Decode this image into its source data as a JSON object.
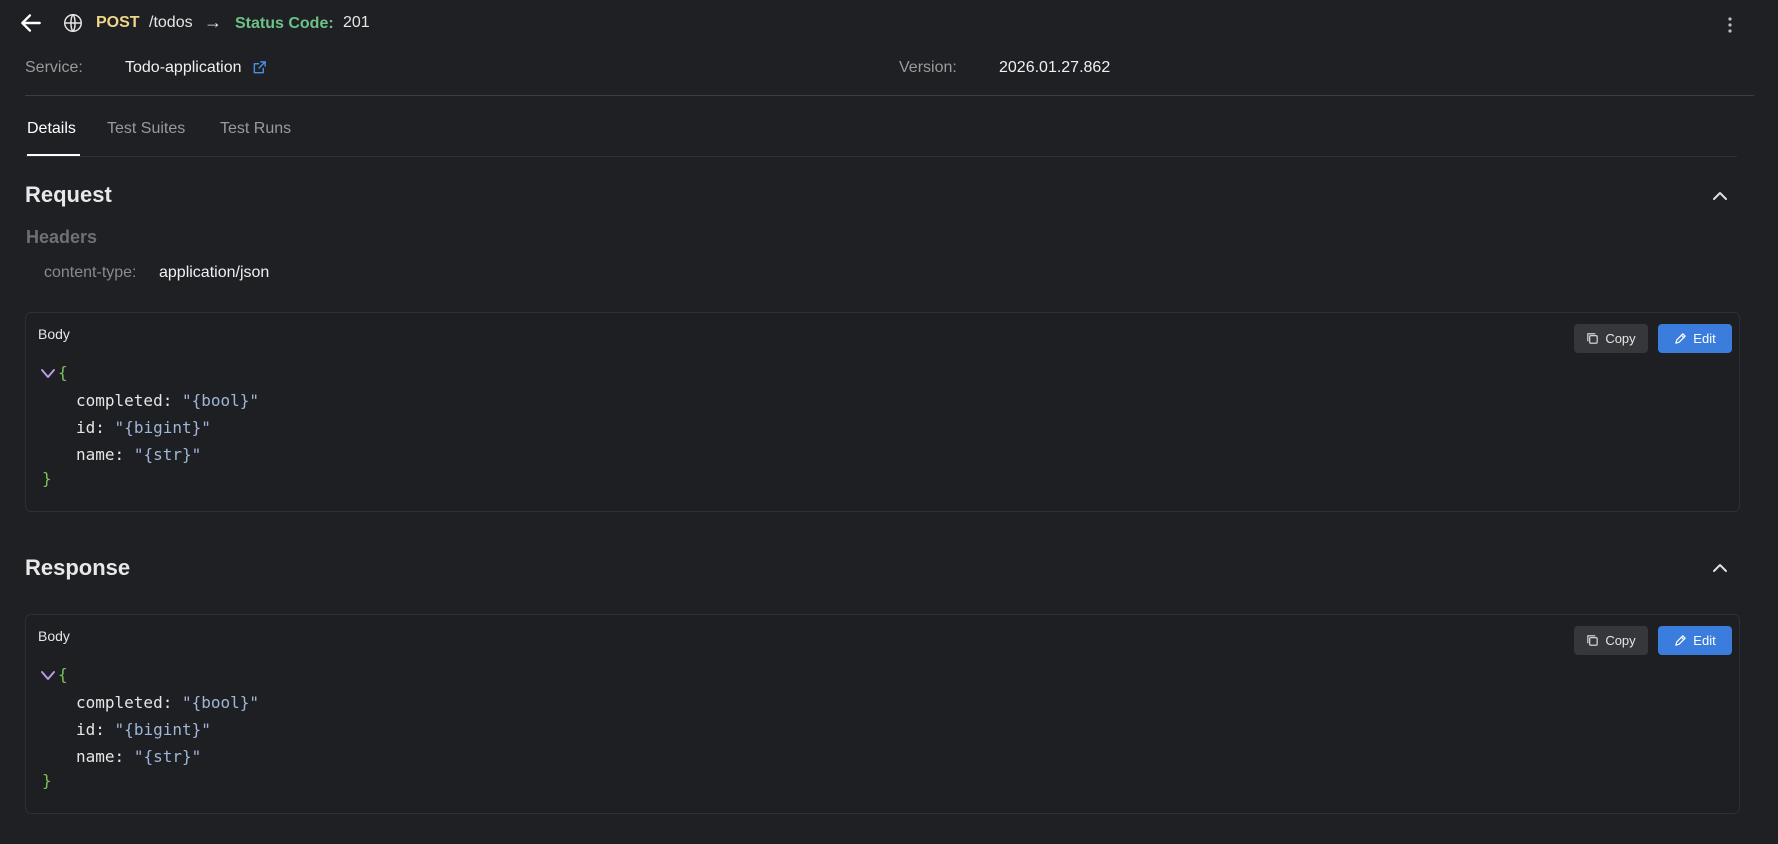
{
  "header": {
    "method": "POST",
    "path": "/todos",
    "arrow": "→",
    "status_label": "Status Code:",
    "status_value": "201",
    "icons": {
      "back": "arrow-left-icon",
      "globe": "globe-icon",
      "menu": "kebab-menu-icon"
    }
  },
  "info": {
    "service_label": "Service:",
    "service_value": "Todo-application",
    "version_label": "Version:",
    "version_value": "2026.01.27.862"
  },
  "tabs": [
    {
      "label": "Details",
      "active": true
    },
    {
      "label": "Test Suites",
      "active": false
    },
    {
      "label": "Test Runs",
      "active": false
    }
  ],
  "request": {
    "title": "Request",
    "headers_title": "Headers",
    "headers": [
      {
        "key": "content-type:",
        "value": "application/json"
      }
    ],
    "body": {
      "label": "Body",
      "copy_label": "Copy",
      "edit_label": "Edit",
      "open": "{",
      "close": "}",
      "fields": [
        {
          "key": "completed:",
          "value": "\"{bool}\""
        },
        {
          "key": "id:",
          "value": "\"{bigint}\""
        },
        {
          "key": "name:",
          "value": "\"{str}\""
        }
      ]
    }
  },
  "response": {
    "title": "Response",
    "body": {
      "label": "Body",
      "copy_label": "Copy",
      "edit_label": "Edit",
      "open": "{",
      "close": "}",
      "fields": [
        {
          "key": "completed:",
          "value": "\"{bool}\""
        },
        {
          "key": "id:",
          "value": "\"{bigint}\""
        },
        {
          "key": "name:",
          "value": "\"{str}\""
        }
      ]
    }
  },
  "colors": {
    "background": "#1f2023",
    "method": "#f0d58a",
    "status": "#6cc287",
    "primary_button": "#3b7ddd",
    "json_brace": "#7cc25a",
    "json_string": "#9fb6d8"
  }
}
